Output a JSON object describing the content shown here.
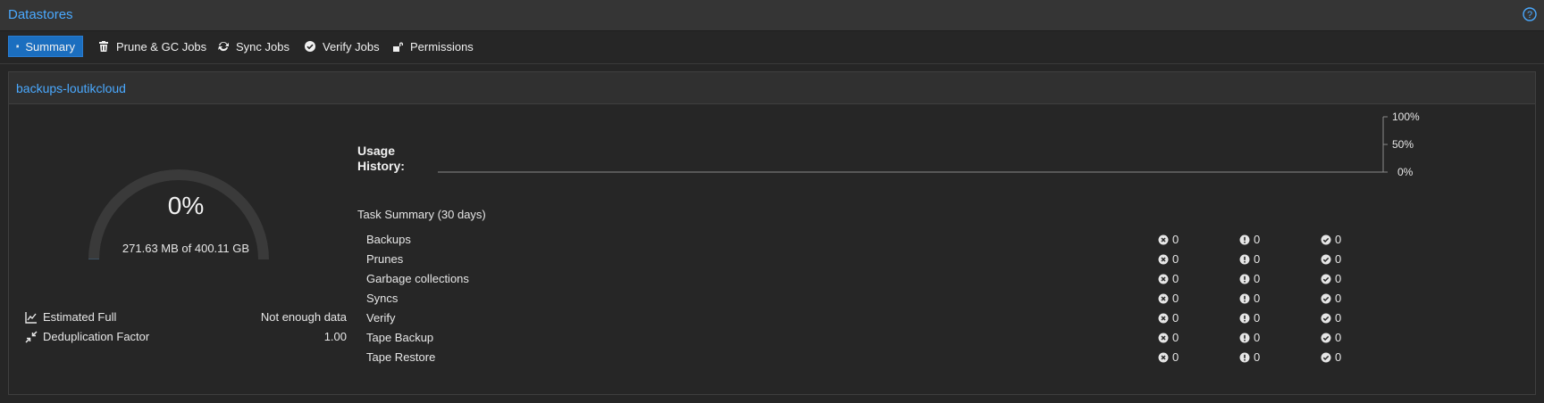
{
  "header": {
    "title": "Datastores"
  },
  "tabs": [
    {
      "label": "Summary",
      "icon": "book-icon",
      "active": true
    },
    {
      "label": "Prune & GC Jobs",
      "icon": "trash-icon"
    },
    {
      "label": "Sync Jobs",
      "icon": "refresh-icon"
    },
    {
      "label": "Verify Jobs",
      "icon": "check-circle-icon"
    },
    {
      "label": "Permissions",
      "icon": "unlock-icon"
    }
  ],
  "datastore": {
    "name": "backups-loutikcloud",
    "usage": {
      "percent_label": "0%",
      "fraction": 0.0007,
      "text": "271.63 MB of 400.11 GB"
    },
    "estimated_full": {
      "label": "Estimated Full",
      "value": "Not enough data"
    },
    "dedup": {
      "label": "Deduplication Factor",
      "value": "1.00"
    },
    "usage_history": {
      "label_line1": "Usage",
      "label_line2": "History:",
      "ticks": [
        "100%",
        "50%",
        "0%"
      ]
    },
    "task_summary": {
      "title": "Task Summary (30 days)",
      "rows": [
        {
          "name": "Backups",
          "errors": "0",
          "warnings": "0",
          "ok": "0"
        },
        {
          "name": "Prunes",
          "errors": "0",
          "warnings": "0",
          "ok": "0"
        },
        {
          "name": "Garbage collections",
          "errors": "0",
          "warnings": "0",
          "ok": "0"
        },
        {
          "name": "Syncs",
          "errors": "0",
          "warnings": "0",
          "ok": "0"
        },
        {
          "name": "Verify",
          "errors": "0",
          "warnings": "0",
          "ok": "0"
        },
        {
          "name": "Tape Backup",
          "errors": "0",
          "warnings": "0",
          "ok": "0"
        },
        {
          "name": "Tape Restore",
          "errors": "0",
          "warnings": "0",
          "ok": "0"
        }
      ]
    }
  },
  "colors": {
    "accent": "#4aa9ff",
    "active_tab": "#1b6ebf",
    "gauge_track": "#3a3a3a"
  }
}
